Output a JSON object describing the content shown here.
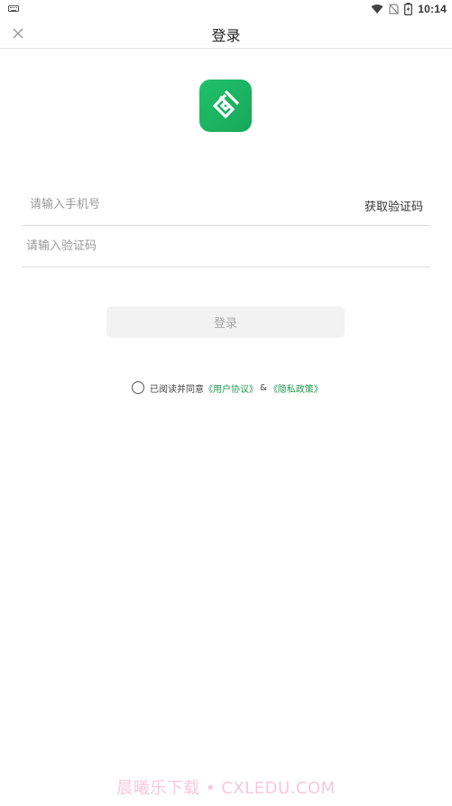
{
  "status_bar": {
    "time": "10:14",
    "icons": [
      "keyboard-icon",
      "wifi-icon",
      "no-sim-icon",
      "battery-charging-icon"
    ]
  },
  "header": {
    "title": "登录",
    "close_icon": "close-icon"
  },
  "logo": {
    "icon": "app-logo-icon",
    "color": "#1fb865"
  },
  "form": {
    "phone_placeholder": "请输入手机号",
    "get_code_label": "获取验证码",
    "code_placeholder": "请输入验证码",
    "submit_label": "登录"
  },
  "agreement": {
    "prefix": "已阅读并同意",
    "user_agreement": "《用户协议》",
    "separator": "&",
    "privacy_policy": "《隐私政策》",
    "link_color": "#1f9a4e"
  },
  "watermark": "晨曦乐下载 • CXLEDU.COM"
}
